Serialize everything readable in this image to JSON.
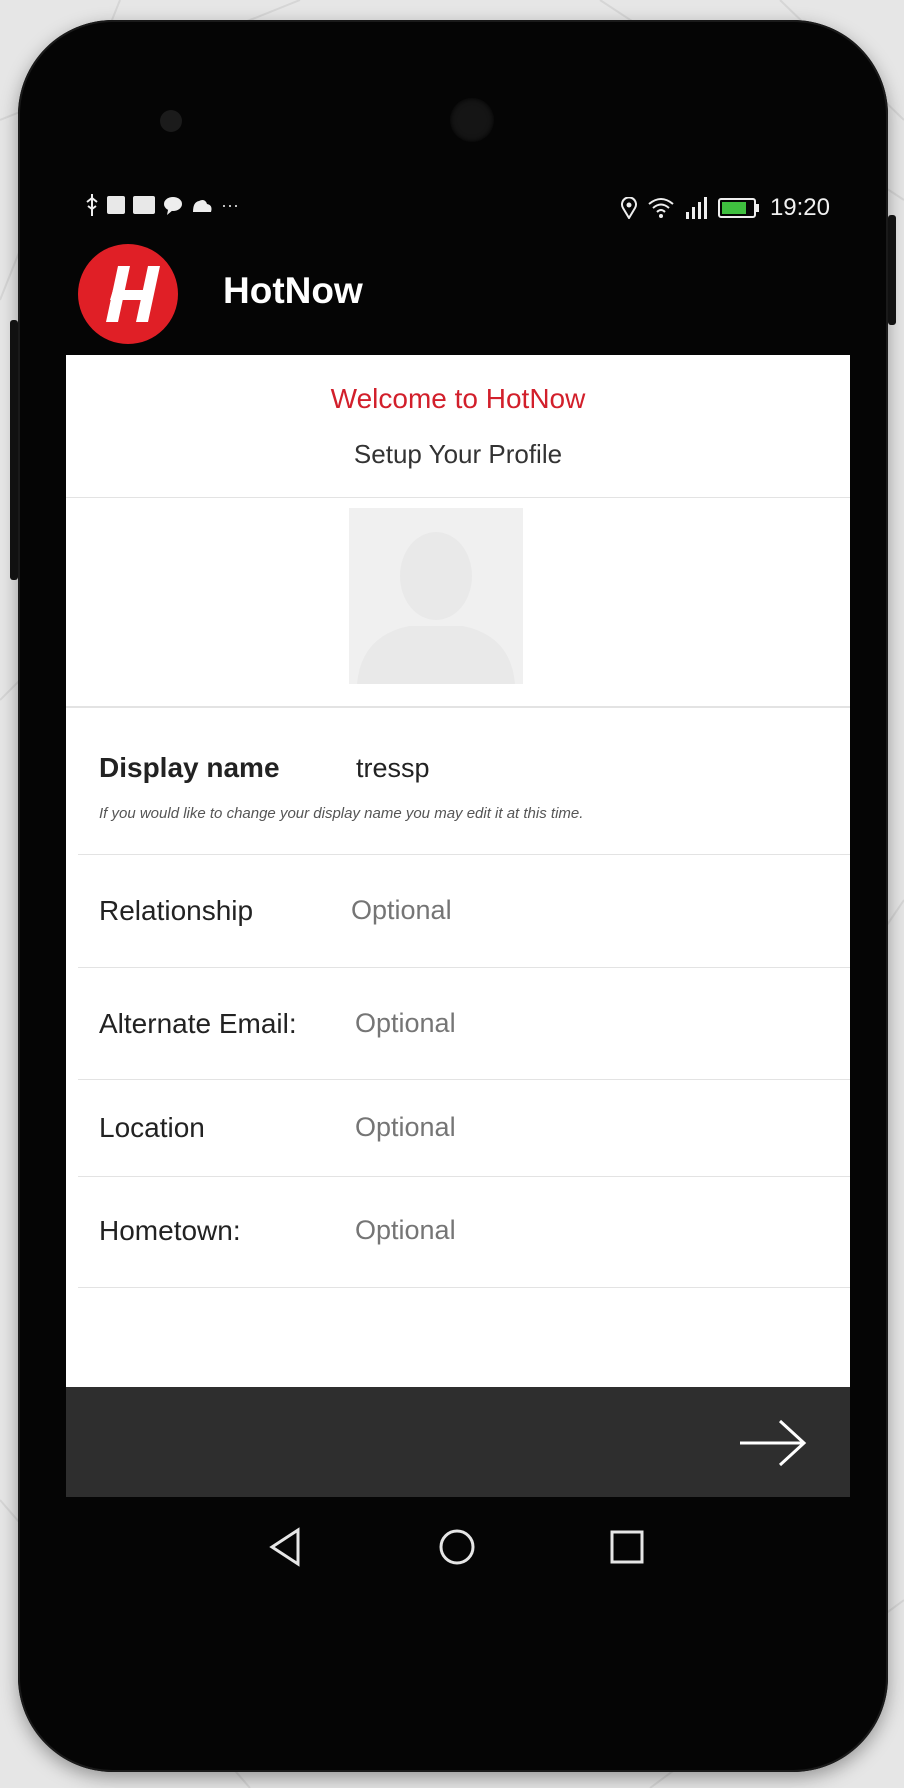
{
  "status_bar": {
    "time": "19:20",
    "battery": "70",
    "left_icons": [
      "usb-icon",
      "image-icon",
      "youtube-icon",
      "chat-icon",
      "cloud-icon",
      "more-icon"
    ],
    "right_icons": [
      "location-icon",
      "wifi-icon",
      "signal-icon",
      "battery-icon"
    ]
  },
  "app_bar": {
    "title": "HotNow",
    "logo_letter": "H"
  },
  "welcome": {
    "title": "Welcome to HotNow",
    "subtitle": "Setup Your Profile"
  },
  "form": {
    "display_name": {
      "label": "Display name",
      "value": "tressp",
      "hint": "If you would like to change your display name you may edit it at this time."
    },
    "relationship": {
      "label": "Relationship",
      "placeholder": "Optional"
    },
    "alternate_email": {
      "label": "Alternate Email:",
      "placeholder": "Optional"
    },
    "location": {
      "label": "Location",
      "placeholder": "Optional"
    },
    "hometown": {
      "label": "Hometown:",
      "placeholder": "Optional"
    }
  },
  "colors": {
    "brand_red": "#e01f26",
    "welcome_red": "#d21f2b",
    "bottom_bar": "#2e2e2e"
  }
}
